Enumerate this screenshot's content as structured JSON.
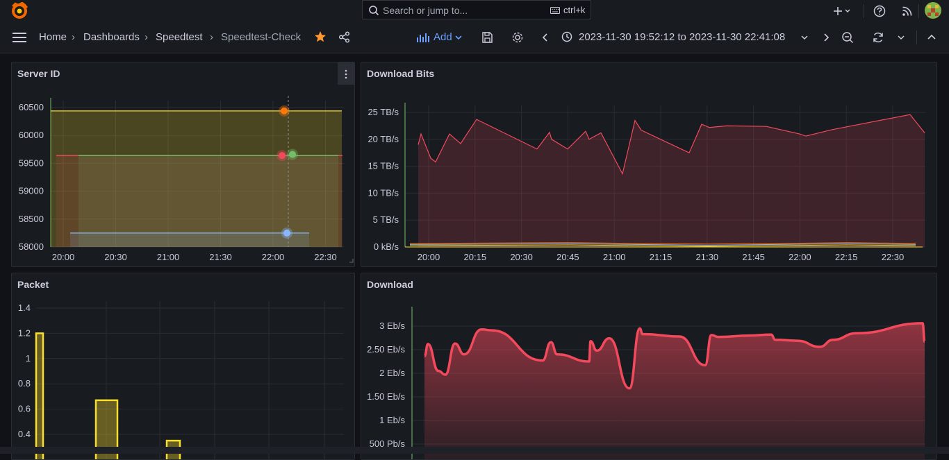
{
  "topbar": {
    "search_placeholder": "Search or jump to...",
    "search_shortcut": "ctrl+k",
    "icons": [
      "grafana-logo-icon",
      "search-icon",
      "keyboard-icon",
      "plus-icon",
      "chevron-down-icon",
      "help-icon",
      "news-rss-icon",
      "user-avatar"
    ]
  },
  "nav": {
    "breadcrumbs": [
      "Home",
      "Dashboards",
      "Speedtest",
      "Speedtest-Check"
    ],
    "add_label": "Add",
    "time_range": "2023-11-30 19:52:12 to 2023-11-30 22:41:08"
  },
  "colors": {
    "accent": "#6e9fff",
    "star": "#ff9830",
    "green": "#73bf69",
    "yellow": "#fade2a",
    "red": "#f2495c",
    "blue": "#8ab8ff",
    "orange": "#ff780a"
  },
  "panels": {
    "server_id": {
      "title": "Server ID"
    },
    "download_bits": {
      "title": "Download Bits"
    },
    "packet": {
      "title": "Packet"
    },
    "download": {
      "title": "Download"
    }
  },
  "chart_data": [
    {
      "type": "line",
      "title": "Server ID",
      "x_ticks": [
        "20:00",
        "20:30",
        "21:00",
        "21:30",
        "22:00",
        "22:30"
      ],
      "y_ticks": [
        "58000",
        "58500",
        "59000",
        "59500",
        "60000",
        "60500"
      ],
      "ylim": [
        58000,
        60600
      ],
      "series": [
        {
          "color": "#fade2a",
          "values": [
            60440,
            60440,
            60440,
            60440,
            60440,
            60440
          ]
        },
        {
          "color": "#f2495c",
          "values": [
            59640,
            59640,
            59640,
            59640,
            59640,
            59640
          ]
        },
        {
          "color": "#73bf69",
          "values": [
            59640,
            59640,
            59640,
            59640,
            59640,
            59640
          ]
        },
        {
          "color": "#8ab8ff",
          "values": [
            58250,
            58250,
            58250,
            58250,
            58250,
            58250
          ]
        }
      ],
      "highlight_points": [
        {
          "color": "#ff780a",
          "value": 60440
        },
        {
          "color": "#f2495c",
          "value": 59640
        },
        {
          "color": "#73bf69",
          "value": 59660
        },
        {
          "color": "#8ab8ff",
          "value": 58250
        }
      ]
    },
    {
      "type": "area",
      "title": "Download Bits",
      "x_ticks": [
        "20:00",
        "20:15",
        "20:30",
        "20:45",
        "21:00",
        "21:15",
        "21:30",
        "21:45",
        "22:00",
        "22:15",
        "22:30"
      ],
      "y_ticks": [
        "0 kB/s",
        "5 TB/s",
        "10 TB/s",
        "15 TB/s",
        "20 TB/s",
        "25 TB/s"
      ],
      "ylim": [
        0,
        27
      ],
      "series": [
        {
          "color": "#f2495c",
          "values": [
            19,
            21,
            16.5,
            15.8,
            21,
            19.2,
            23.7,
            18.2,
            21.3,
            20,
            18.2,
            21.5,
            20,
            21.2,
            13.6,
            23.5,
            21.7,
            17.5,
            22.8,
            22.2,
            22.5,
            22.4,
            21,
            20.6,
            21.8,
            24.6,
            21.2
          ]
        },
        {
          "color": "#fade2a",
          "values": [
            0.5,
            0.5,
            0.5,
            0.5,
            0.5,
            0.5
          ]
        },
        {
          "color": "#8ab8ff",
          "values": [
            0.8,
            0.8,
            0.8,
            0.8,
            0.8,
            0.8
          ]
        },
        {
          "color": "#ff780a",
          "values": [
            0.3,
            0.3,
            0.3,
            0.3,
            0.3,
            0.3
          ]
        }
      ]
    },
    {
      "type": "bar",
      "title": "Packet",
      "y_ticks": [
        "0.4",
        "0.6",
        "0.8",
        "1",
        "1.2",
        "1.4"
      ],
      "ylim": [
        0,
        1.4
      ],
      "values": [
        1.2,
        0.67,
        0.35
      ],
      "series": [
        {
          "color": "#fade2a",
          "values": [
            1.2,
            0.67,
            0.35
          ]
        }
      ]
    },
    {
      "type": "area",
      "title": "Download",
      "y_ticks": [
        "500 Pb/s",
        "1 Eb/s",
        "1.50 Eb/s",
        "2 Eb/s",
        "2.50 Eb/s",
        "3 Eb/s"
      ],
      "ylim": [
        0.4,
        3.2
      ],
      "series": [
        {
          "color": "#f2495c",
          "values": [
            2.36,
            2.62,
            2.05,
            1.97,
            2.63,
            2.4,
            2.93,
            2.91,
            2.27,
            2.66,
            2.4,
            2.25,
            2.68,
            2.48,
            2.74,
            1.68,
            2.95,
            2.83,
            2.78,
            2.17,
            2.81,
            2.77,
            2.8,
            2.82,
            2.71,
            2.69,
            2.56,
            2.71,
            2.85,
            3.06,
            2.67
          ]
        }
      ]
    }
  ]
}
